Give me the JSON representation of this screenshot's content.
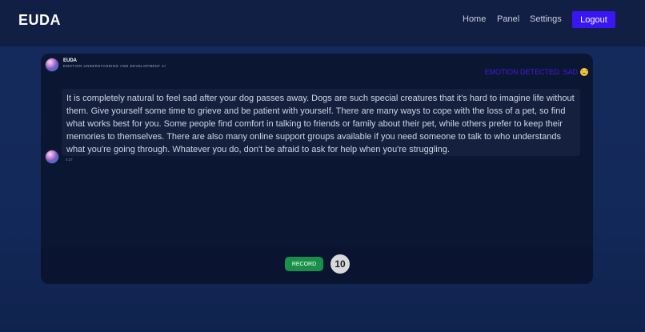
{
  "app": {
    "brand": "EUDA"
  },
  "nav": {
    "home": "Home",
    "panel": "Panel",
    "settings": "Settings",
    "logout": "Logout"
  },
  "chat": {
    "header": {
      "name": "EUDA",
      "subtitle": "EMOTION UNDERSTANDING AND DEVELOPMENT AI"
    },
    "emotion": {
      "label": "EMOTION DETECTED: SAD",
      "icon": "sad-face-emoji"
    },
    "message": {
      "text": "It is completely natural to feel sad after your dog passes away. Dogs are such special creatures that it's hard to imagine life without them. Give yourself some time to grieve and be patient with yourself. There are many ways to cope with the loss of a pet, so find what works best for you. Some people find comfort in talking to friends or family about their pet, while others prefer to keep their memories to themselves. There are also many online support groups available if you need someone to talk to who understands what you're going through. Whatever you do, don't be afraid to ask for help when you're struggling.",
      "time": "4:27"
    },
    "controls": {
      "record_label": "RECORD",
      "counter": "10"
    }
  },
  "colors": {
    "logout_bg": "#3a16f5",
    "emotion_text": "#3d1fe0",
    "record_bg": "#1a8f4a"
  }
}
